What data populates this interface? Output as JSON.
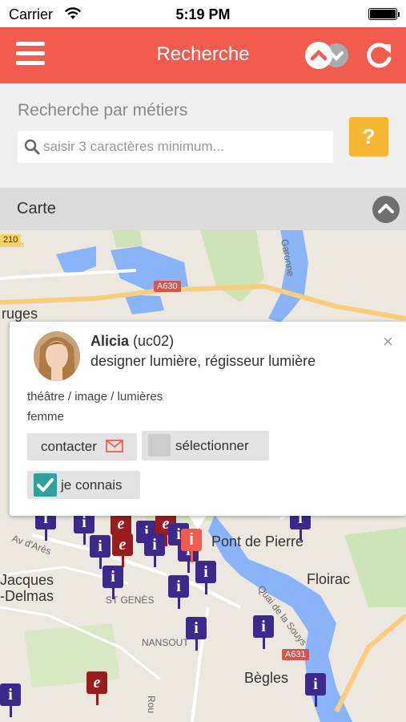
{
  "status_bar": {
    "carrier": "Carrier",
    "time": "5:19 PM"
  },
  "header": {
    "title": "Recherche",
    "menu_icon": "hamburger-icon",
    "toggle_icon": "map-list-toggle-icon",
    "refresh_icon": "refresh-icon",
    "color": "#f25c4f"
  },
  "search": {
    "label": "Recherche par métiers",
    "placeholder": "saisir 3 caractères minimum...",
    "value": "",
    "help_label": "?",
    "help_color": "#f7b733"
  },
  "map_section": {
    "title": "Carte"
  },
  "map": {
    "labels": {
      "bruges": "ruges",
      "pont_de_pierre": "Pont de Pierre",
      "floirac": "Floirac",
      "jacques": "Jacques",
      "delmas": "-Delmas",
      "begles": "Bègles",
      "st_genes": "ST GENÈS",
      "nansout": "NANSOUT",
      "av_ares": "Av d'Arès",
      "quai_souys": "Quai de la Souys",
      "garonne": "Garonne",
      "a630": "A630",
      "a631": "A631",
      "d210": "210",
      "rou": "Rou"
    },
    "pin_i": "i",
    "pin_e": "e"
  },
  "popup": {
    "first_name": "Alicia",
    "user_code": "(uc02)",
    "jobs": "designer lumière, régisseur lumière",
    "categories": "théâtre / image / lumières",
    "gender": "femme",
    "close_label": "×",
    "contact_label": "contacter",
    "select_label": "sélectionner",
    "know_label": "je connais",
    "know_checked": true,
    "select_checked": false
  }
}
